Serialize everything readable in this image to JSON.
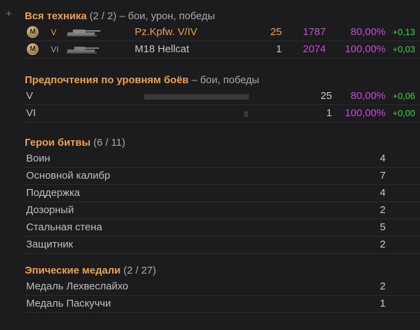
{
  "expander_icon": "plus-icon",
  "vehicles": {
    "title": "Вся техника",
    "count": "(2 / 2)",
    "suffix": " – бои, урон, победы",
    "rows": [
      {
        "tier": "V",
        "name": "Pz.Kpfw. V/IV",
        "battles": "25",
        "damage": "1787",
        "winrate": "80,00%",
        "delta": "+0,13",
        "medal": "M"
      },
      {
        "tier": "VI",
        "name": "M18 Hellcat",
        "battles": "1",
        "damage": "2074",
        "winrate": "100,00%",
        "delta": "+0,03",
        "medal": "M"
      }
    ]
  },
  "tier_prefs": {
    "title": "Предпочтения по уровням боёв",
    "suffix": " – бои, победы",
    "rows": [
      {
        "tier": "V",
        "battles": "25",
        "winrate": "80,00%",
        "delta": "+0,06",
        "share": 1.0
      },
      {
        "tier": "VI",
        "battles": "1",
        "winrate": "100,00%",
        "delta": "+0,00",
        "share": 0.04
      }
    ]
  },
  "heroes": {
    "title": "Герои битвы",
    "count": "(6 / 11)",
    "rows": [
      {
        "name": "Воин",
        "value": "4"
      },
      {
        "name": "Основной калибр",
        "value": "7"
      },
      {
        "name": "Поддержка",
        "value": "4"
      },
      {
        "name": "Дозорный",
        "value": "2"
      },
      {
        "name": "Стальная стена",
        "value": "5"
      },
      {
        "name": "Защитник",
        "value": "2"
      }
    ]
  },
  "epic": {
    "title": "Эпические медали",
    "count": "(2 / 27)",
    "rows": [
      {
        "name": "Медаль Лехвеслайхо",
        "value": "2"
      },
      {
        "name": "Медаль Паскуччи",
        "value": "1"
      }
    ]
  }
}
